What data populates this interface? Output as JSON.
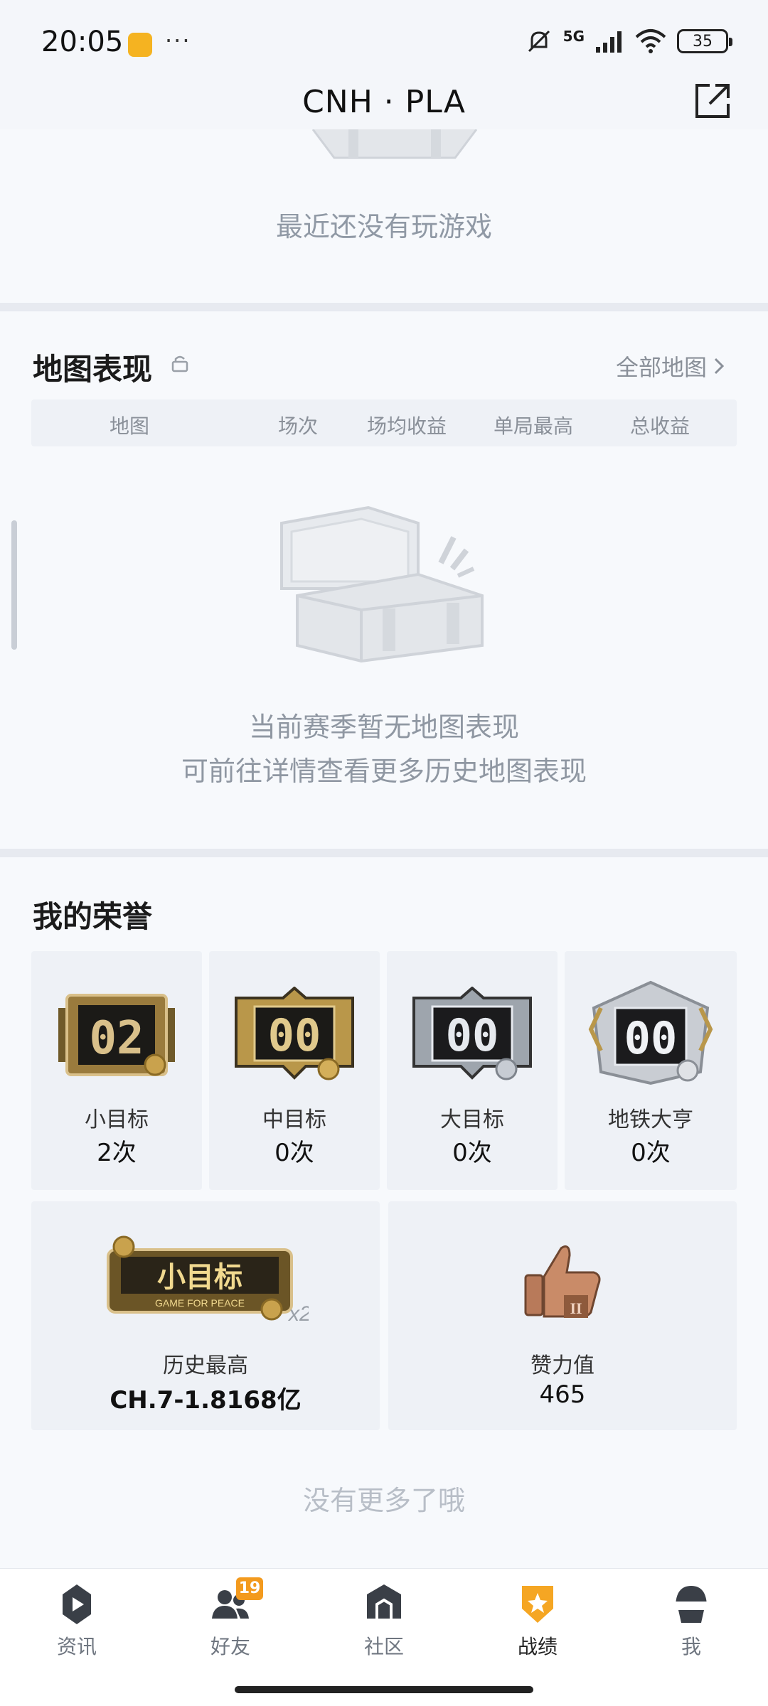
{
  "status_bar": {
    "time": "20:05",
    "network": "5G",
    "battery": "35",
    "more": "···"
  },
  "header": {
    "title": "CNH · PLA",
    "share_icon": "external-link-icon"
  },
  "recent_games": {
    "empty_text": "最近还没有玩游戏"
  },
  "map_performance": {
    "title": "地图表现",
    "all_maps_link": "全部地图",
    "columns": [
      "地图",
      "场次",
      "场均收益",
      "单局最高",
      "总收益"
    ],
    "empty_line1": "当前赛季暂无地图表现",
    "empty_line2": "可前往详情查看更多历史地图表现"
  },
  "honors": {
    "title": "我的荣誉",
    "tiles": [
      {
        "badge": "02",
        "label": "小目标",
        "value": "2次",
        "color": "#9a7b3d"
      },
      {
        "badge": "00",
        "label": "中目标",
        "value": "0次",
        "color": "#b9974a"
      },
      {
        "badge": "00",
        "label": "大目标",
        "value": "0次",
        "color": "#9ea5ad"
      },
      {
        "badge": "00",
        "label": "地铁大亨",
        "value": "0次",
        "color": "#c9cdd3"
      }
    ],
    "history": {
      "badge_text": "小目标",
      "badge_sub": "GAME FOR PEACE",
      "multiplier": "x2",
      "label": "历史最高",
      "value": "CH.7-1.8168亿"
    },
    "likes": {
      "label": "赞力值",
      "value": "465",
      "badge_mark": "II"
    }
  },
  "footer_note": "没有更多了哦",
  "nav": {
    "items": [
      {
        "label": "资讯",
        "icon": "news-icon"
      },
      {
        "label": "好友",
        "icon": "friends-icon",
        "badge": "19"
      },
      {
        "label": "社区",
        "icon": "community-icon"
      },
      {
        "label": "战绩",
        "icon": "records-icon",
        "active": true
      },
      {
        "label": "我",
        "icon": "profile-icon"
      }
    ]
  },
  "colors": {
    "accent": "#f5a623",
    "badge": "#f39a1e",
    "muted_text": "#8f97a2"
  }
}
